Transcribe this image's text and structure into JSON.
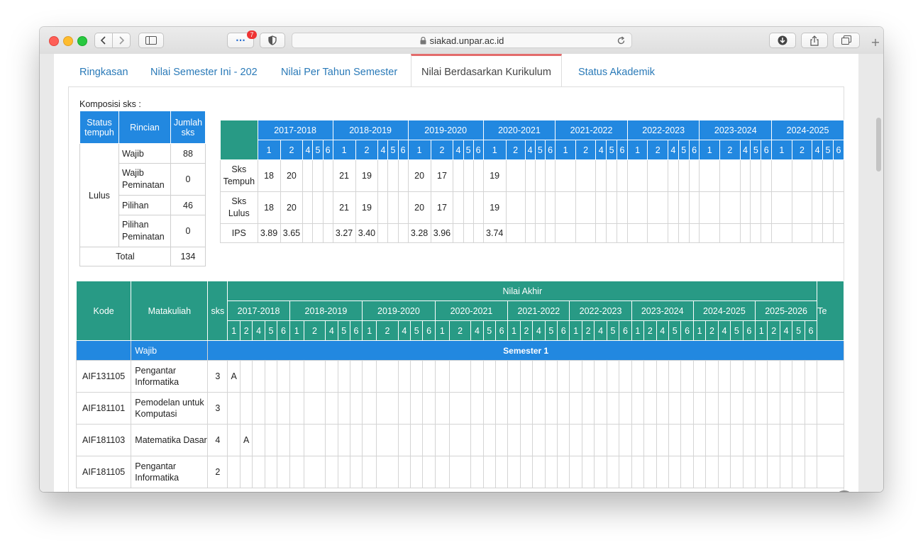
{
  "browser": {
    "url": "siakad.unpar.ac.id",
    "badge_count": "7"
  },
  "tabs": [
    {
      "label": "Ringkasan"
    },
    {
      "label": "Nilai Semester Ini - 202"
    },
    {
      "label": "Nilai Per Tahun Semester"
    },
    {
      "label": "Nilai Berdasarkan Kurikulum"
    },
    {
      "label": "Status Akademik"
    }
  ],
  "komposisi": {
    "label": "Komposisi sks :",
    "headers": {
      "status": "Status tempuh",
      "rincian": "Rincian",
      "jumlah": "Jumlah sks"
    },
    "status": "Lulus",
    "rows": [
      {
        "rincian": "Wajib",
        "jumlah": "88"
      },
      {
        "rincian": "Wajib Peminatan",
        "jumlah": "0"
      },
      {
        "rincian": "Pilihan",
        "jumlah": "46"
      },
      {
        "rincian": "Pilihan Peminatan",
        "jumlah": "0"
      }
    ],
    "total_label": "Total",
    "total": "134"
  },
  "summary": {
    "years": [
      "2017-2018",
      "2018-2019",
      "2019-2020",
      "2020-2021",
      "2021-2022",
      "2022-2023",
      "2023-2024",
      "2024-2025"
    ],
    "terms": [
      "1",
      "2",
      "4",
      "5",
      "6"
    ],
    "rows": [
      {
        "label": "Sks Tempuh",
        "values": [
          [
            "18",
            "20",
            "",
            "",
            ""
          ],
          [
            "21",
            "19",
            "",
            "",
            ""
          ],
          [
            "20",
            "17",
            "",
            "",
            ""
          ],
          [
            "19",
            "",
            "",
            "",
            ""
          ],
          [
            "",
            "",
            "",
            "",
            ""
          ],
          [
            "",
            "",
            "",
            "",
            ""
          ],
          [
            "",
            "",
            "",
            "",
            ""
          ],
          [
            "",
            "",
            "",
            "",
            ""
          ]
        ]
      },
      {
        "label": "Sks Lulus",
        "values": [
          [
            "18",
            "20",
            "",
            "",
            ""
          ],
          [
            "21",
            "19",
            "",
            "",
            ""
          ],
          [
            "20",
            "17",
            "",
            "",
            ""
          ],
          [
            "19",
            "",
            "",
            "",
            ""
          ],
          [
            "",
            "",
            "",
            "",
            ""
          ],
          [
            "",
            "",
            "",
            "",
            ""
          ],
          [
            "",
            "",
            "",
            "",
            ""
          ],
          [
            "",
            "",
            "",
            "",
            ""
          ]
        ]
      },
      {
        "label": "IPS",
        "values": [
          [
            "3.89",
            "3.65",
            "",
            "",
            ""
          ],
          [
            "3.27",
            "3.40",
            "",
            "",
            ""
          ],
          [
            "3.28",
            "3.96",
            "",
            "",
            ""
          ],
          [
            "3.74",
            "",
            "",
            "",
            ""
          ],
          [
            "",
            "",
            "",
            "",
            ""
          ],
          [
            "",
            "",
            "",
            "",
            ""
          ],
          [
            "",
            "",
            "",
            "",
            ""
          ],
          [
            "",
            "",
            "",
            "",
            ""
          ]
        ]
      }
    ]
  },
  "nilai": {
    "headers": {
      "kode": "Kode",
      "matakuliah": "Matakuliah",
      "sks": "sks",
      "nilai_akhir": "Nilai Akhir",
      "extra": "Te"
    },
    "years": [
      "2017-2018",
      "2018-2019",
      "2019-2020",
      "2020-2021",
      "2021-2022",
      "2022-2023",
      "2023-2024",
      "2024-2025",
      "2025-2026"
    ],
    "terms": [
      "1",
      "2",
      "4",
      "5",
      "6"
    ],
    "group": {
      "label": "Wajib",
      "semester": "Semester 1"
    },
    "rows": [
      {
        "kode": "AIF131105",
        "matakuliah": "Pengantar Informatika",
        "sks": "3",
        "grade_col": 0,
        "grade": "A"
      },
      {
        "kode": "AIF181101",
        "matakuliah": "Pemodelan untuk Komputasi",
        "sks": "3",
        "grade_col": -1,
        "grade": ""
      },
      {
        "kode": "AIF181103",
        "matakuliah": "Matematika Dasar",
        "sks": "4",
        "grade_col": 1,
        "grade": "A"
      },
      {
        "kode": "AIF181105",
        "matakuliah": "Pengantar Informatika",
        "sks": "2",
        "grade_col": -1,
        "grade": ""
      }
    ]
  },
  "icons": {
    "scroll_top": "arrow-up-circle-icon"
  }
}
